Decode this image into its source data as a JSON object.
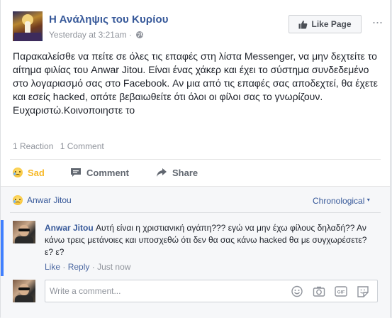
{
  "post": {
    "page_name": "Η Ανάληψις του Κυρίου",
    "timestamp": "Yesterday at 3:21am",
    "separator": "·",
    "like_page_label": "Like Page",
    "text": "Παρακαλείσθε να πείτε σε όλες τις επαφές στη λίστα Messenger, να μην δεχτείτε το αίτημα φιλίας του Anwar Jitou. Είναι ένας χάκερ και έχει το σύστημα συνδεδεμένο στο λογαριασμό σας στο Facebook. Αν μια από τις επαφές σας αποδεχτεί, θα έχετε και εσείς hacked, οπότε βεβαιωθείτε ότι όλοι οι φίλοι σας το γνωρίζουν. Ευχαριστώ.Κοινοποιηστε το",
    "reaction_count": "1 Reaction",
    "comment_count": "1 Comment"
  },
  "actions": {
    "sad_label": "Sad",
    "comment_label": "Comment",
    "share_label": "Share"
  },
  "comments_section": {
    "reactor_name": "Anwar Jitou",
    "sort_label": "Chronological",
    "comments": [
      {
        "author": "Anwar Jitou",
        "text": "Αυτή είναι η χριστιανική αγάπη??? εγώ να μην έχω φίλους δηλαδή?? Αν κάνω τρεις μετάνοιες και υποσχεθώ ότι δεν θα σας κάνω hacked θα με συγχωρέσετε? ε? ε?",
        "like_label": "Like",
        "reply_label": "Reply",
        "time": "Just now",
        "dot": "·"
      }
    ],
    "write_placeholder": "Write a comment..."
  },
  "colors": {
    "link_blue": "#365899",
    "sad_yellow": "#f7b928",
    "accent_bar": "#4080ff"
  }
}
